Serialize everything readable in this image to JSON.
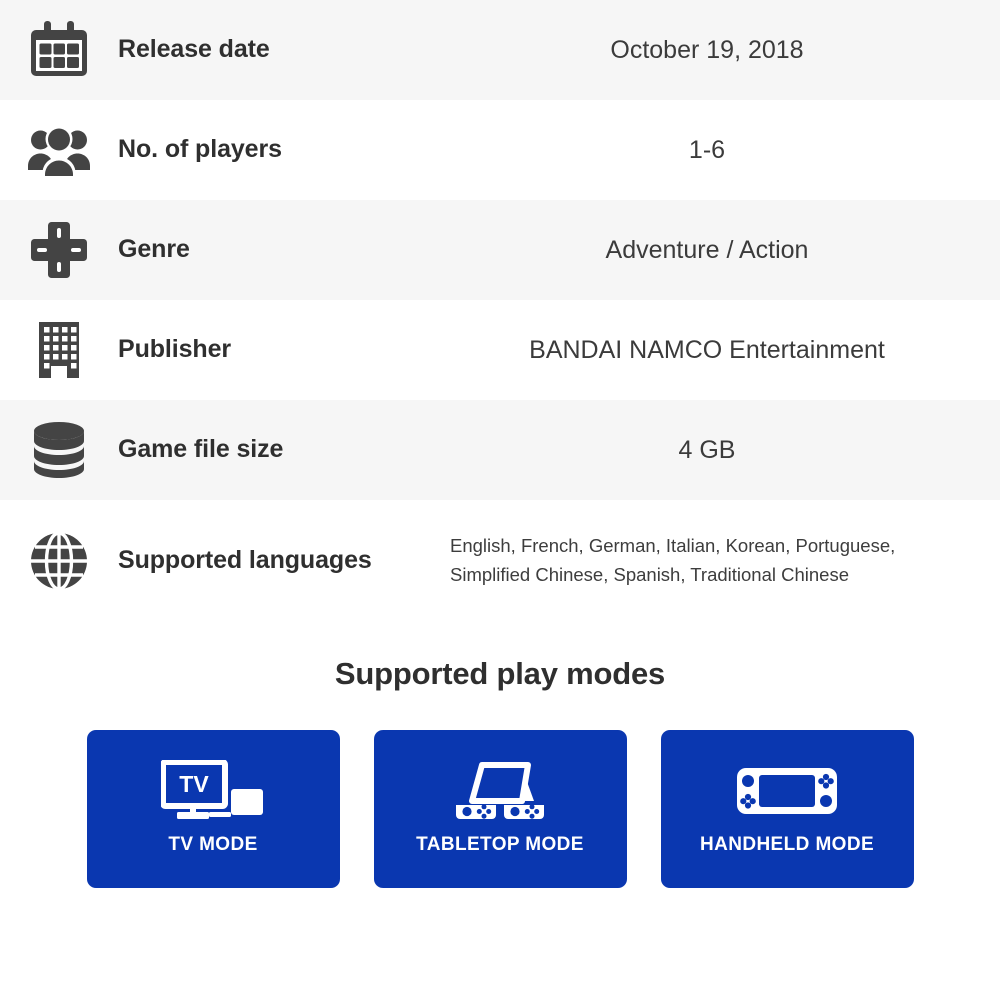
{
  "spec_table": {
    "rows": [
      {
        "icon": "calendar-icon",
        "label": "Release date",
        "value": "October 19, 2018"
      },
      {
        "icon": "players-group-icon",
        "label": "No. of players",
        "value": "1-6"
      },
      {
        "icon": "dpad-icon",
        "label": "Genre",
        "value": "Adventure / Action"
      },
      {
        "icon": "building-icon",
        "label": "Publisher",
        "value": "BANDAI NAMCO Entertainment"
      },
      {
        "icon": "database-icon",
        "label": "Game file size",
        "value": "4 GB"
      },
      {
        "icon": "globe-icon",
        "label": "Supported languages",
        "value": "English, French, German, Italian, Korean, Portuguese, Simplified Chinese, Spanish, Traditional Chinese"
      }
    ],
    "supported_languages_list": [
      "English",
      "French",
      "German",
      "Italian",
      "Korean",
      "Portuguese",
      "Simplified Chinese",
      "Spanish",
      "Traditional Chinese"
    ]
  },
  "play_modes": {
    "title": "Supported play modes",
    "cards": [
      {
        "icon": "tv-mode-icon",
        "label": "TV MODE",
        "screen_text": "TV"
      },
      {
        "icon": "tabletop-mode-icon",
        "label": "TABLETOP MODE"
      },
      {
        "icon": "handheld-mode-icon",
        "label": "HANDHELD MODE"
      }
    ]
  },
  "colors": {
    "card_blue": "#0a37b0",
    "row_alt_background": "#f6f6f6",
    "row_background": "#ffffff",
    "icon_gray": "#444444",
    "label_text": "#2f2f2f",
    "value_text": "#3b3b3b",
    "card_text": "#ffffff"
  }
}
